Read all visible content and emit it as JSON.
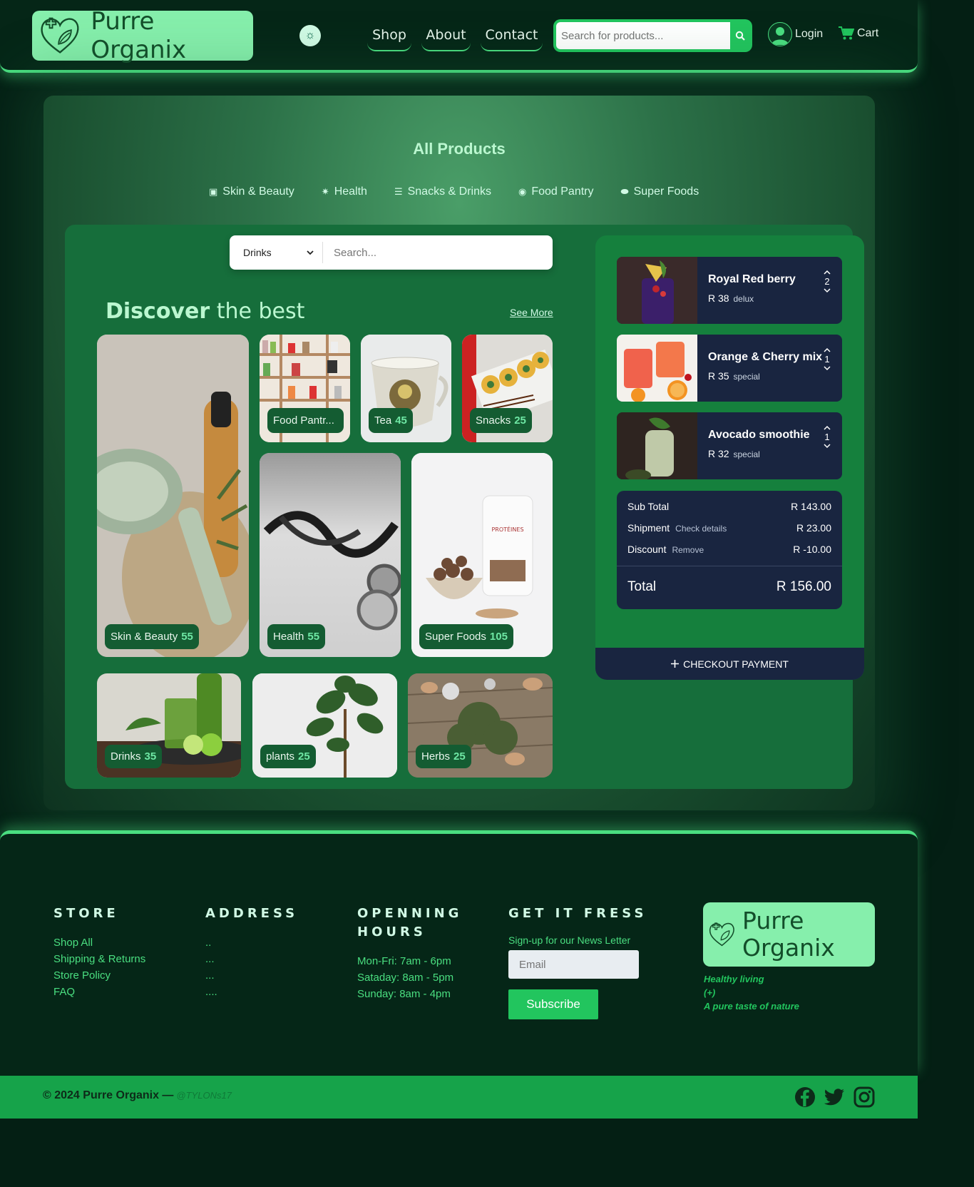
{
  "header": {
    "brand": "Purre Organix",
    "nav": [
      "Shop",
      "About",
      "Contact"
    ],
    "search_placeholder": "Search for products...",
    "login_label": "Login",
    "cart_label": "Cart"
  },
  "main": {
    "title": "All Products",
    "categories": [
      "Skin & Beauty",
      "Health",
      "Snacks & Drinks",
      "Food Pantry",
      "Super Foods"
    ],
    "filter": {
      "selected": "Drinks",
      "placeholder": "Search..."
    },
    "discover": {
      "bold": "Discover",
      "rest": "the best",
      "see_more": "See More"
    },
    "tiles": [
      {
        "label": "Skin & Beauty",
        "count": "55"
      },
      {
        "label": "Food Pantr...",
        "count": ""
      },
      {
        "label": "Tea",
        "count": "45"
      },
      {
        "label": "Snacks",
        "count": "25"
      },
      {
        "label": "Health",
        "count": "55"
      },
      {
        "label": "Super Foods",
        "count": "105"
      },
      {
        "label": "Drinks",
        "count": "35"
      },
      {
        "label": "plants",
        "count": "25"
      },
      {
        "label": "Herbs",
        "count": "25"
      }
    ]
  },
  "cart": {
    "items": [
      {
        "name": "Royal Red berry",
        "price": "R 38",
        "tier": "delux",
        "qty": "2"
      },
      {
        "name": "Orange & Cherry mix",
        "price": "R 35",
        "tier": "special",
        "qty": "1"
      },
      {
        "name": "Avocado smoothie",
        "price": "R 32",
        "tier": "special",
        "qty": "1"
      }
    ],
    "subtotal_label": "Sub Total",
    "subtotal": "R 143.00",
    "shipment_label": "Shipment",
    "shipment_note": "Check details",
    "shipment": "R 23.00",
    "discount_label": "Discount",
    "discount_note": "Remove",
    "discount": "R -10.00",
    "total_label": "Total",
    "total": "R 156.00",
    "checkout_label": "CHECKOUT PAYMENT"
  },
  "footer": {
    "store_title": "STORE",
    "store_links": [
      "Shop All",
      "Shipping & Returns",
      "Store Policy",
      "FAQ"
    ],
    "address_title": "ADDRESS",
    "address_lines": [
      "..",
      "...",
      "...",
      "...."
    ],
    "hours_title": "OPENNING HOURS",
    "hours": [
      "Mon-Fri: 7am - 6pm",
      "Sataday: 8am - 5pm",
      "Sunday: 8am - 4pm"
    ],
    "news_title": "GET IT FRESS",
    "news_sub": "Sign-up for our News Letter",
    "email_placeholder": "Email",
    "subscribe_label": "Subscribe",
    "brand": "Purre Organix",
    "slogan": [
      "Healthy living",
      "(+)",
      "A pure taste of nature"
    ],
    "copyright": "© 2024 Purre Organix —",
    "handle": "@TYLONs17"
  },
  "colors": {
    "accent": "#4ade80",
    "brand_bg": "#86efac",
    "header_bg": "#052617",
    "cart_card": "#192540",
    "panel": "#15803d"
  }
}
